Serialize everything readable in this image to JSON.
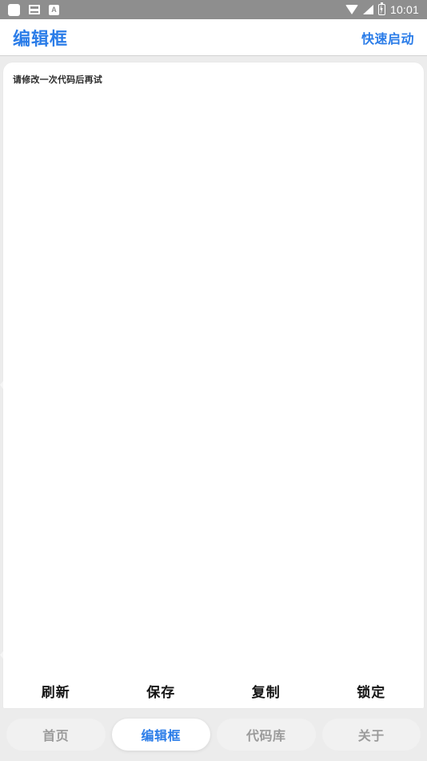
{
  "status_bar": {
    "icons_left": [
      "app-square-icon",
      "card-icon",
      "letter-a-icon"
    ],
    "icons_right": [
      "wifi-icon",
      "signal-icon",
      "battery-charging-icon"
    ],
    "time": "10:01"
  },
  "header": {
    "title": "编辑框",
    "quick_launch_label": "快速启动"
  },
  "editor": {
    "content": "请修改一次代码后再试",
    "placeholder": "请修改一次代码后再试"
  },
  "actions": [
    {
      "label": "刷新",
      "name": "refresh"
    },
    {
      "label": "保存",
      "name": "save"
    },
    {
      "label": "复制",
      "name": "copy"
    },
    {
      "label": "锁定",
      "name": "lock"
    }
  ],
  "tabs": [
    {
      "label": "首页",
      "name": "home",
      "active": false
    },
    {
      "label": "编辑框",
      "name": "editor",
      "active": true
    },
    {
      "label": "代码库",
      "name": "code-library",
      "active": false
    },
    {
      "label": "关于",
      "name": "about",
      "active": false
    }
  ],
  "colors": {
    "accent": "#2a7ce8",
    "status_bar_bg": "#8e8e8e",
    "page_bg": "#ececec",
    "card_bg": "#ffffff",
    "tab_inactive_bg": "#f1f1f1",
    "tab_inactive_text": "#9b9b9b"
  }
}
